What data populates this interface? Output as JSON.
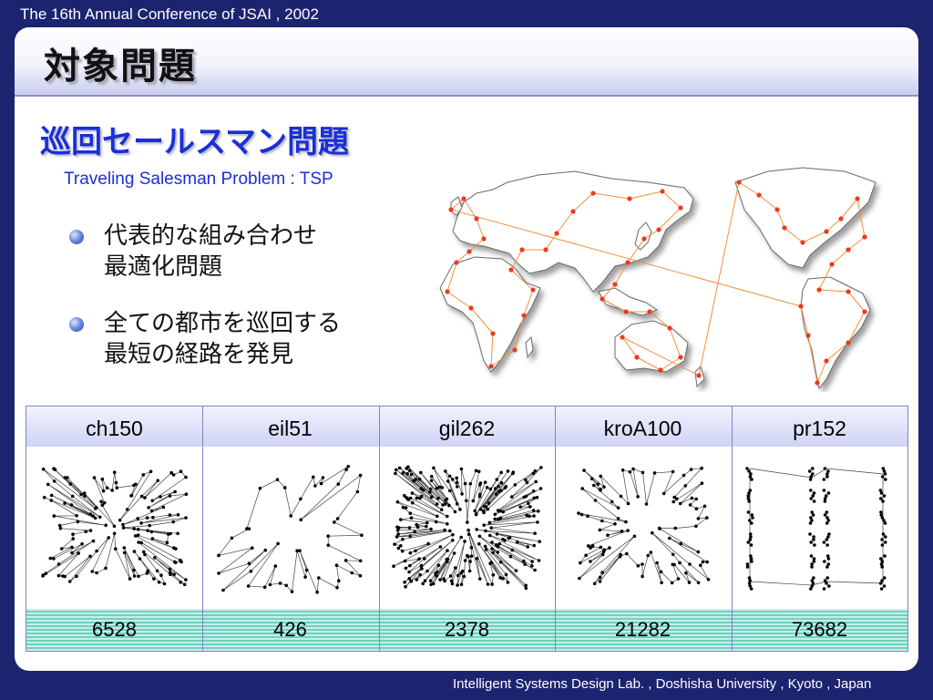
{
  "header": {
    "conference": "The 16th Annual Conference of JSAI , 2002"
  },
  "slide": {
    "title": "対象問題",
    "subtitle": "巡回セールスマン問題",
    "subtitle_en": "Traveling Salesman Problem : TSP",
    "bullets": [
      {
        "line1": "代表的な組み合わせ",
        "line2": "最適化問題"
      },
      {
        "line1": "全ての都市を巡回する",
        "line2": "最短の経路を発見"
      }
    ]
  },
  "instances": [
    {
      "name": "ch150",
      "value": "6528"
    },
    {
      "name": "eil51",
      "value": "426"
    },
    {
      "name": "gil262",
      "value": "2378"
    },
    {
      "name": "kroA100",
      "value": "21282"
    },
    {
      "name": "pr152",
      "value": "73682"
    }
  ],
  "footer": {
    "text": "Intelligent Systems Design Lab. , Doshisha University , Kyoto , Japan"
  },
  "colors": {
    "background": "#1c2470",
    "accent": "#1a2fd6",
    "city": "#ee3a1a",
    "route": "#f39040",
    "value_row": "#6fd0c0"
  }
}
